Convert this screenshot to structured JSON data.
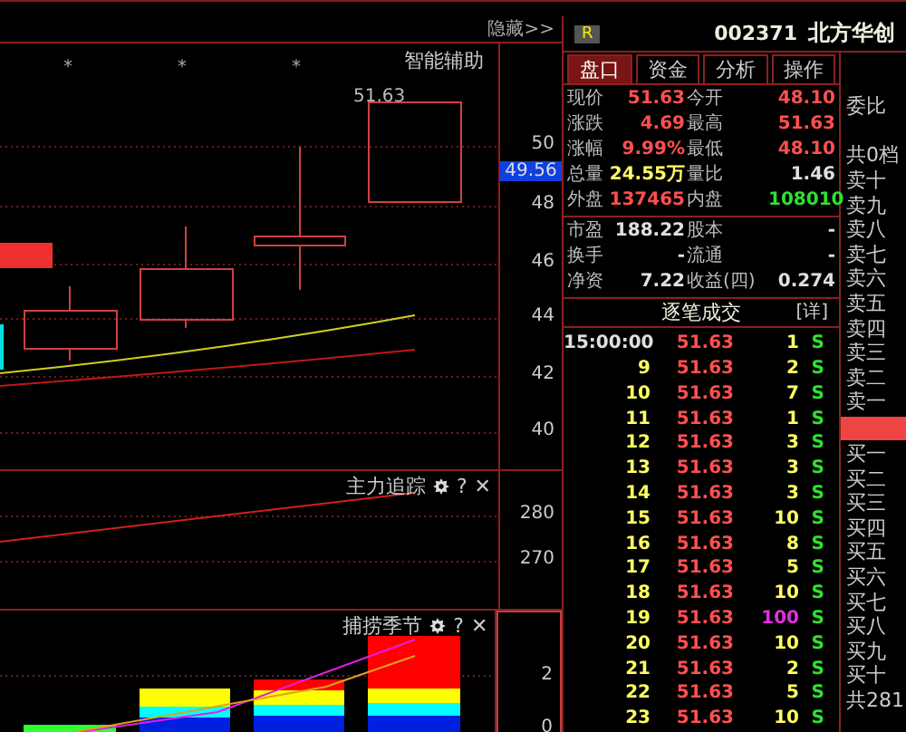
{
  "toolbar": {
    "hide_button": "隐藏>>"
  },
  "main_chart": {
    "title": "智能辅助",
    "markers": [
      "*",
      "*",
      "*"
    ],
    "price_label": "51.63",
    "axis_labels": [
      "50",
      "48",
      "46",
      "44",
      "42",
      "40"
    ],
    "current_price_tag": "49.56"
  },
  "indicators": [
    {
      "kind": "line",
      "title": "主力追踪",
      "help": "?",
      "close": "✕",
      "axis_labels": [
        "280",
        "270"
      ]
    },
    {
      "kind": "bars",
      "title": "捕捞季节",
      "help": "?",
      "close": "✕",
      "axis_labels": [
        "2",
        "0"
      ]
    }
  ],
  "stock": {
    "badge": "R",
    "code": "002371",
    "name": "北方华创"
  },
  "tabs": [
    {
      "label": "盘口",
      "selected": true
    },
    {
      "label": "资金",
      "selected": false
    },
    {
      "label": "分析",
      "selected": false
    },
    {
      "label": "操作",
      "selected": false
    }
  ],
  "quote_groups": [
    [
      {
        "cells": [
          {
            "label": "现价",
            "value": "51.63",
            "color": "#ff5050"
          },
          {
            "label": "今开",
            "value": "48.10",
            "color": "#ff5050"
          }
        ]
      },
      {
        "cells": [
          {
            "label": "涨跌",
            "value": "4.69",
            "color": "#ff5050"
          },
          {
            "label": "最高",
            "value": "51.63",
            "color": "#ff5050"
          }
        ]
      },
      {
        "cells": [
          {
            "label": "涨幅",
            "value": "9.99%",
            "color": "#ff5050"
          },
          {
            "label": "最低",
            "value": "48.10",
            "color": "#ff5050"
          }
        ]
      },
      {
        "cells": [
          {
            "label": "总量",
            "value": "24.55万",
            "color": "#ffff60"
          },
          {
            "label": "量比",
            "value": "1.46",
            "color": "#e0e0e0"
          }
        ]
      },
      {
        "cells": [
          {
            "label": "外盘",
            "value": "137465",
            "color": "#ff5050"
          },
          {
            "label": "内盘",
            "value": "108010",
            "color": "#30e030"
          }
        ]
      }
    ],
    [
      {
        "cells": [
          {
            "label": "市盈",
            "value": "188.22",
            "color": "#e0e0e0"
          },
          {
            "label": "股本",
            "value": "-",
            "color": "#e0e0e0"
          }
        ]
      },
      {
        "cells": [
          {
            "label": "换手",
            "value": "-",
            "color": "#e0e0e0"
          },
          {
            "label": "流通",
            "value": "-",
            "color": "#e0e0e0"
          }
        ]
      },
      {
        "cells": [
          {
            "label": "净资",
            "value": "7.22",
            "color": "#e0e0e0"
          },
          {
            "label": "收益(四)",
            "value": "0.274",
            "color": "#e0e0e0"
          }
        ]
      }
    ]
  ],
  "trades": {
    "title": "逐笔成交",
    "detail": "[详]",
    "rows": [
      {
        "kind": "time",
        "time": "15:00:00",
        "price": "51.63",
        "volume": "1",
        "side": "S",
        "large": false
      },
      {
        "kind": "seq",
        "time": "9",
        "price": "51.63",
        "volume": "2",
        "side": "S",
        "large": false
      },
      {
        "kind": "seq",
        "time": "10",
        "price": "51.63",
        "volume": "7",
        "side": "S",
        "large": false
      },
      {
        "kind": "seq",
        "time": "11",
        "price": "51.63",
        "volume": "1",
        "side": "S",
        "large": false
      },
      {
        "kind": "seq",
        "time": "12",
        "price": "51.63",
        "volume": "3",
        "side": "S",
        "large": false
      },
      {
        "kind": "seq",
        "time": "13",
        "price": "51.63",
        "volume": "3",
        "side": "S",
        "large": false
      },
      {
        "kind": "seq",
        "time": "14",
        "price": "51.63",
        "volume": "3",
        "side": "S",
        "large": false
      },
      {
        "kind": "seq",
        "time": "15",
        "price": "51.63",
        "volume": "10",
        "side": "S",
        "large": false
      },
      {
        "kind": "seq",
        "time": "16",
        "price": "51.63",
        "volume": "8",
        "side": "S",
        "large": false
      },
      {
        "kind": "seq",
        "time": "17",
        "price": "51.63",
        "volume": "5",
        "side": "S",
        "large": false
      },
      {
        "kind": "seq",
        "time": "18",
        "price": "51.63",
        "volume": "10",
        "side": "S",
        "large": false
      },
      {
        "kind": "seq",
        "time": "19",
        "price": "51.63",
        "volume": "100",
        "side": "S",
        "large": true
      },
      {
        "kind": "seq",
        "time": "20",
        "price": "51.63",
        "volume": "10",
        "side": "S",
        "large": false
      },
      {
        "kind": "seq",
        "time": "21",
        "price": "51.63",
        "volume": "2",
        "side": "S",
        "large": false
      },
      {
        "kind": "seq",
        "time": "22",
        "price": "51.63",
        "volume": "5",
        "side": "S",
        "large": false
      },
      {
        "kind": "seq",
        "time": "23",
        "price": "51.63",
        "volume": "10",
        "side": "S",
        "large": false
      }
    ]
  },
  "order_book": {
    "ratio_label": "委比",
    "summary_top": "共0档",
    "asks": [
      "卖十",
      "卖九",
      "卖八",
      "卖七",
      "卖六",
      "卖五",
      "卖四",
      "卖三",
      "卖二",
      "卖一"
    ],
    "bids": [
      "买一",
      "买二",
      "买三",
      "买四",
      "买五",
      "买六",
      "买七",
      "买八",
      "买九",
      "买十"
    ],
    "summary_bottom": "共281"
  }
}
